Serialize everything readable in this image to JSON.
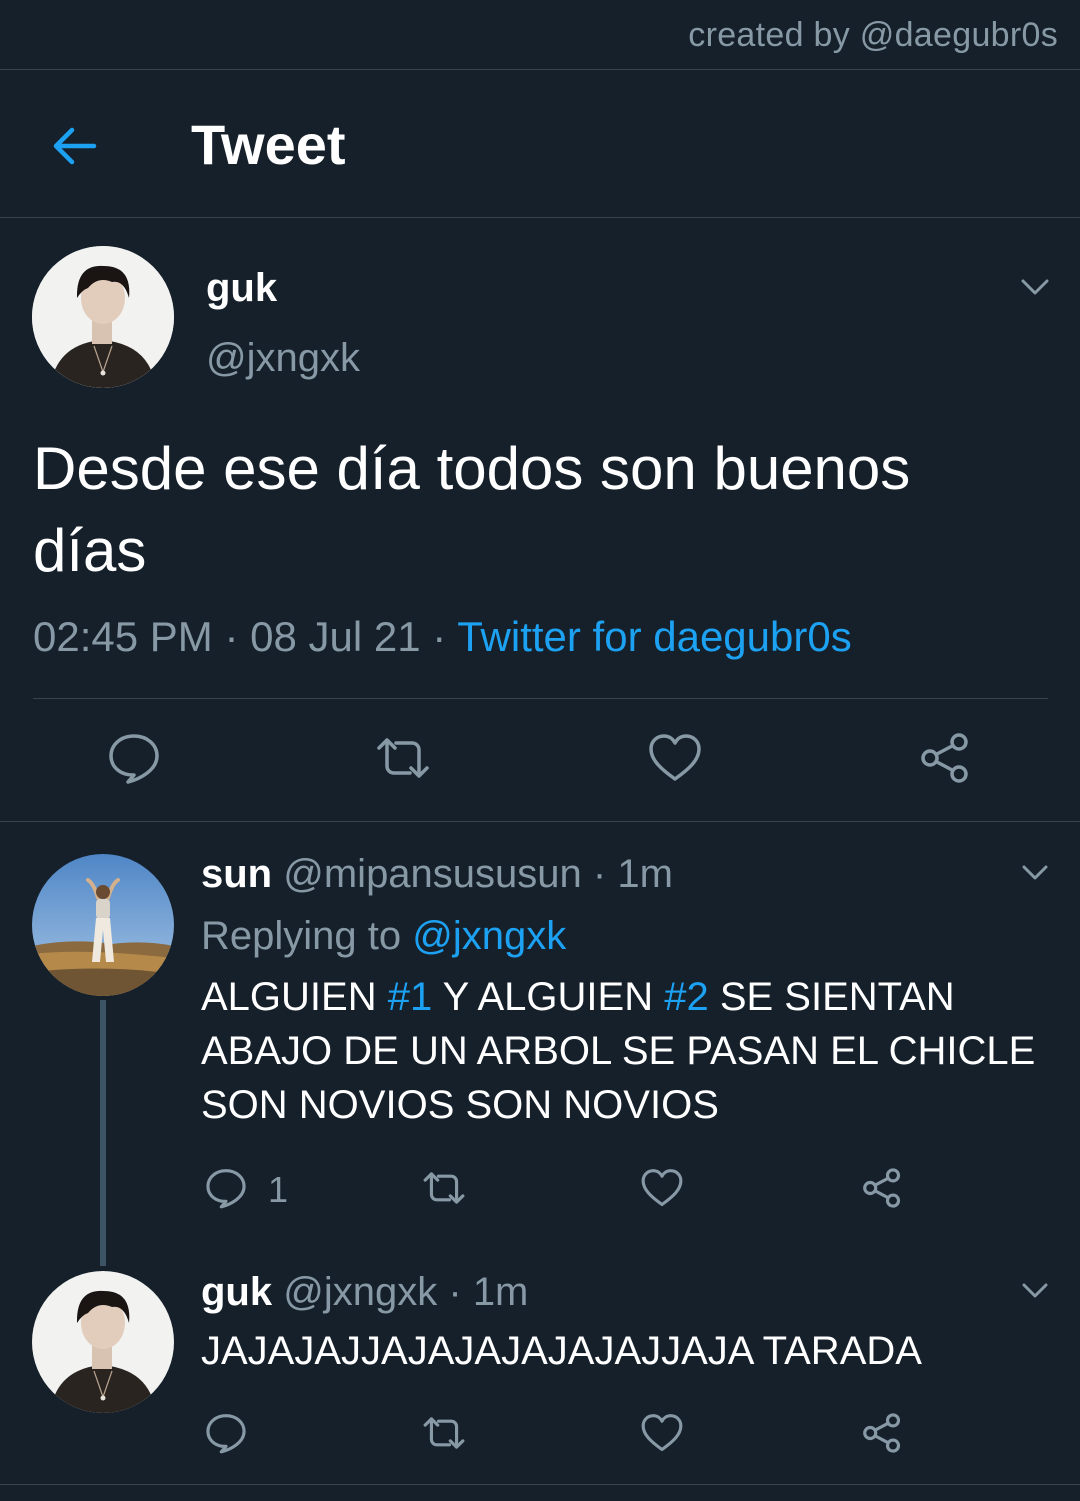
{
  "credit": "created by @daegubr0s",
  "header": {
    "title": "Tweet"
  },
  "tweet": {
    "name": "guk",
    "handle": "@jxngxk",
    "text": "Desde ese día todos son buenos días",
    "time": "02:45 PM",
    "date": "08 Jul 21",
    "separator": "·",
    "source": "Twitter for daegubr0s"
  },
  "replies": [
    {
      "name": "sun",
      "handle": "@mipansususun",
      "time": "1m",
      "replying_label": "Replying to",
      "replying_to": "@jxngxk",
      "text_parts": [
        "ALGUIEN ",
        "#1",
        " Y ALGUIEN ",
        "#2",
        " SE SIENTAN ABAJO DE UN ARBOL SE PASAN EL CHICLE SON NOVIOS SON NOVIOS"
      ],
      "reply_count": "1"
    },
    {
      "name": "guk",
      "handle": "@jxngxk",
      "time": "1m",
      "text": "JAJAJAJJAJAJAJAJAJAJJAJA TARADA"
    }
  ],
  "colors": {
    "background": "#15202b",
    "accent": "#1da1f2",
    "muted": "#8899a6",
    "divider": "#38444d"
  },
  "icons": [
    "back-arrow-icon",
    "chevron-down-icon",
    "reply-icon",
    "retweet-icon",
    "like-icon",
    "share-icon"
  ]
}
